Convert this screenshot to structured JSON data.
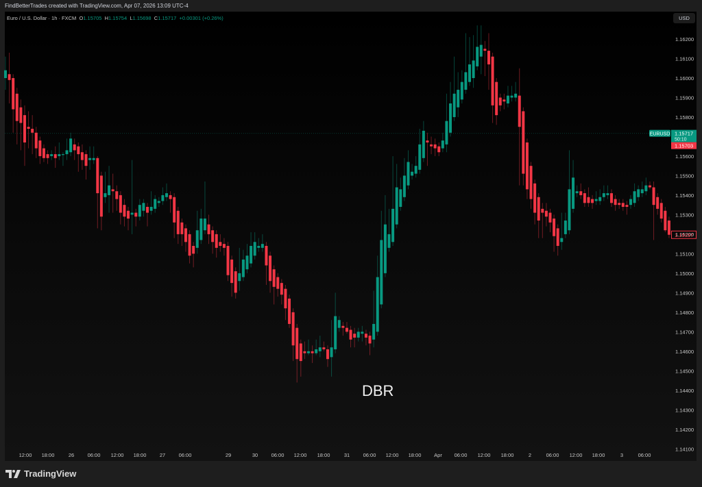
{
  "header": {
    "attribution": "FindBetterTrades created with TradingView.com, Apr 07, 2026 13:09 UTC-4"
  },
  "legend": {
    "symbol": "Euro / U.S. Dollar · 1h · FXCM",
    "o_label": "O",
    "o": "1.15705",
    "h_label": "H",
    "h": "1.15754",
    "l_label": "L",
    "l": "1.15698",
    "c_label": "C",
    "c": "1.15717",
    "change": "+0.00301 (+0.26%)"
  },
  "currency_button": "USD",
  "price_badges": {
    "symbol": "EURUSD",
    "last": "1.15717",
    "countdown": "50:10",
    "bid": "1.15703",
    "marker": "1.15197"
  },
  "annotation": "DBR",
  "footer": {
    "brand": "TradingView"
  },
  "colors": {
    "up": "#089981",
    "down": "#f23645"
  },
  "chart_data": {
    "type": "candlestick",
    "title": "Euro / U.S. Dollar · 1h · FXCM",
    "ylim": [
      1.141,
      1.1628
    ],
    "yticks": [
      "1.16200",
      "1.16100",
      "1.16000",
      "1.15900",
      "1.15800",
      "1.15700",
      "1.15600",
      "1.15500",
      "1.15400",
      "1.15300",
      "1.15200",
      "1.15100",
      "1.15000",
      "1.14900",
      "1.14800",
      "1.14700",
      "1.14600",
      "1.14500",
      "1.14400",
      "1.14300",
      "1.14200",
      "1.14100"
    ],
    "xticks": [
      "12:00",
      "18:00",
      "26",
      "06:00",
      "12:00",
      "18:00",
      "27",
      "06:00",
      "29",
      "30",
      "06:00",
      "12:00",
      "18:00",
      "31",
      "06:00",
      "12:00",
      "18:00",
      "Apr",
      "06:00",
      "12:00",
      "18:00",
      "2",
      "06:00",
      "12:00",
      "18:00",
      "3",
      "06:00"
    ],
    "current_price": 1.15717,
    "ohlc": [
      [
        1.16,
        1.1611,
        1.1594,
        1.1604
      ],
      [
        1.1602,
        1.1613,
        1.1587,
        1.1599
      ],
      [
        1.16,
        1.1602,
        1.1572,
        1.1584
      ],
      [
        1.1592,
        1.1595,
        1.1566,
        1.1578
      ],
      [
        1.1585,
        1.1589,
        1.1563,
        1.1577
      ],
      [
        1.1581,
        1.1586,
        1.1555,
        1.1567
      ],
      [
        1.1575,
        1.1583,
        1.1564,
        1.1574
      ],
      [
        1.1574,
        1.1581,
        1.1561,
        1.1572
      ],
      [
        1.1572,
        1.1575,
        1.1559,
        1.1564
      ],
      [
        1.1568,
        1.157,
        1.1556,
        1.156
      ],
      [
        1.1564,
        1.1566,
        1.1557,
        1.1559
      ],
      [
        1.1561,
        1.1563,
        1.1556,
        1.1559
      ],
      [
        1.156,
        1.1563,
        1.1558,
        1.1561
      ],
      [
        1.1561,
        1.1565,
        1.1554,
        1.1559
      ],
      [
        1.156,
        1.1567,
        1.1558,
        1.1561
      ],
      [
        1.1561,
        1.1562,
        1.1555,
        1.1561
      ],
      [
        1.1561,
        1.1569,
        1.1558,
        1.1563
      ],
      [
        1.1562,
        1.1572,
        1.156,
        1.1569
      ],
      [
        1.1566,
        1.1569,
        1.1558,
        1.1563
      ],
      [
        1.1565,
        1.1567,
        1.1552,
        1.1561
      ],
      [
        1.1562,
        1.1566,
        1.1553,
        1.1558
      ],
      [
        1.1561,
        1.1563,
        1.1548,
        1.1555
      ],
      [
        1.1558,
        1.1565,
        1.1553,
        1.1559
      ],
      [
        1.1558,
        1.1565,
        1.1556,
        1.1559
      ],
      [
        1.1559,
        1.156,
        1.1523,
        1.1541
      ],
      [
        1.155,
        1.1552,
        1.1522,
        1.1529
      ],
      [
        1.1539,
        1.1552,
        1.1536,
        1.1541
      ],
      [
        1.154,
        1.1555,
        1.1531,
        1.1545
      ],
      [
        1.1543,
        1.1551,
        1.1531,
        1.1542
      ],
      [
        1.1542,
        1.1545,
        1.1532,
        1.1538
      ],
      [
        1.154,
        1.1542,
        1.1525,
        1.1531
      ],
      [
        1.1535,
        1.1538,
        1.1524,
        1.1529
      ],
      [
        1.1532,
        1.1534,
        1.1522,
        1.1528
      ],
      [
        1.153,
        1.1558,
        1.152,
        1.1531
      ],
      [
        1.1531,
        1.1533,
        1.1524,
        1.1529
      ],
      [
        1.1529,
        1.1538,
        1.1527,
        1.1535
      ],
      [
        1.1532,
        1.1538,
        1.1529,
        1.1536
      ],
      [
        1.1534,
        1.1536,
        1.1524,
        1.1531
      ],
      [
        1.1532,
        1.1542,
        1.153,
        1.1534
      ],
      [
        1.1533,
        1.154,
        1.1531,
        1.1538
      ],
      [
        1.1536,
        1.1539,
        1.1534,
        1.1537
      ],
      [
        1.1537,
        1.1544,
        1.1535,
        1.154
      ],
      [
        1.1539,
        1.1546,
        1.1537,
        1.1541
      ],
      [
        1.154,
        1.1542,
        1.1531,
        1.1538
      ],
      [
        1.1539,
        1.1541,
        1.1518,
        1.1526
      ],
      [
        1.1532,
        1.1534,
        1.1515,
        1.152
      ],
      [
        1.1526,
        1.1528,
        1.1514,
        1.152
      ],
      [
        1.1523,
        1.1525,
        1.1511,
        1.1516
      ],
      [
        1.152,
        1.1522,
        1.1505,
        1.1509
      ],
      [
        1.1514,
        1.1516,
        1.1503,
        1.151
      ],
      [
        1.1513,
        1.1532,
        1.151,
        1.1522
      ],
      [
        1.1517,
        1.1533,
        1.1515,
        1.1528
      ],
      [
        1.1522,
        1.1547,
        1.152,
        1.1528
      ],
      [
        1.1525,
        1.153,
        1.1515,
        1.152
      ],
      [
        1.1522,
        1.1524,
        1.151,
        1.1516
      ],
      [
        1.152,
        1.1522,
        1.1508,
        1.1513
      ],
      [
        1.1516,
        1.152,
        1.1511,
        1.1514
      ],
      [
        1.1515,
        1.1518,
        1.1509,
        1.1513
      ],
      [
        1.1514,
        1.1516,
        1.1496,
        1.1499
      ],
      [
        1.1507,
        1.1509,
        1.1488,
        1.1495
      ],
      [
        1.1501,
        1.1503,
        1.1487,
        1.149
      ],
      [
        1.1496,
        1.1513,
        1.1491,
        1.15
      ],
      [
        1.1498,
        1.1512,
        1.1496,
        1.1507
      ],
      [
        1.1502,
        1.1515,
        1.15,
        1.1509
      ],
      [
        1.1505,
        1.1521,
        1.1503,
        1.1514
      ],
      [
        1.1509,
        1.1521,
        1.1507,
        1.1516
      ],
      [
        1.1513,
        1.1518,
        1.1511,
        1.1514
      ],
      [
        1.1513,
        1.152,
        1.1511,
        1.1515
      ],
      [
        1.1514,
        1.1516,
        1.1494,
        1.1504
      ],
      [
        1.1509,
        1.1511,
        1.149,
        1.1496
      ],
      [
        1.1502,
        1.1504,
        1.1484,
        1.1493
      ],
      [
        1.1498,
        1.15,
        1.1488,
        1.1492
      ],
      [
        1.1495,
        1.1497,
        1.1484,
        1.1489
      ],
      [
        1.1492,
        1.1494,
        1.1476,
        1.1482
      ],
      [
        1.1487,
        1.1489,
        1.1472,
        1.1474
      ],
      [
        1.148,
        1.1482,
        1.1455,
        1.1463
      ],
      [
        1.1472,
        1.1474,
        1.1444,
        1.1456
      ],
      [
        1.1464,
        1.1466,
        1.1447,
        1.1455
      ],
      [
        1.146,
        1.1465,
        1.1456,
        1.1459
      ],
      [
        1.1459,
        1.1466,
        1.1458,
        1.146
      ],
      [
        1.146,
        1.1463,
        1.1454,
        1.1459
      ],
      [
        1.1459,
        1.1466,
        1.1458,
        1.1461
      ],
      [
        1.146,
        1.1468,
        1.1457,
        1.1462
      ],
      [
        1.1462,
        1.1465,
        1.146,
        1.1461
      ],
      [
        1.1461,
        1.1463,
        1.1452,
        1.1456
      ],
      [
        1.1457,
        1.1476,
        1.1447,
        1.1462
      ],
      [
        1.1461,
        1.149,
        1.1459,
        1.1478
      ],
      [
        1.1472,
        1.1478,
        1.147,
        1.1476
      ],
      [
        1.1473,
        1.1475,
        1.1468,
        1.1472
      ],
      [
        1.1472,
        1.1475,
        1.1469,
        1.147
      ],
      [
        1.1471,
        1.1473,
        1.1462,
        1.1466
      ],
      [
        1.1469,
        1.1472,
        1.1462,
        1.1467
      ],
      [
        1.1467,
        1.1472,
        1.1465,
        1.147
      ],
      [
        1.1469,
        1.1473,
        1.1465,
        1.147
      ],
      [
        1.1469,
        1.1471,
        1.1463,
        1.1467
      ],
      [
        1.1468,
        1.147,
        1.1458,
        1.1464
      ],
      [
        1.1466,
        1.1491,
        1.1462,
        1.1474
      ],
      [
        1.147,
        1.1509,
        1.1468,
        1.1498
      ],
      [
        1.1484,
        1.1532,
        1.1482,
        1.1517
      ],
      [
        1.15,
        1.154,
        1.1498,
        1.1525
      ],
      [
        1.1513,
        1.1533,
        1.1511,
        1.152
      ],
      [
        1.1516,
        1.156,
        1.1514,
        1.1533
      ],
      [
        1.1525,
        1.1556,
        1.1523,
        1.1544
      ],
      [
        1.1534,
        1.1549,
        1.1532,
        1.1543
      ],
      [
        1.1539,
        1.1559,
        1.1537,
        1.155
      ],
      [
        1.1545,
        1.1563,
        1.1543,
        1.1557
      ],
      [
        1.155,
        1.1556,
        1.1548,
        1.1552
      ],
      [
        1.1551,
        1.156,
        1.1549,
        1.1555
      ],
      [
        1.1553,
        1.1574,
        1.1551,
        1.1566
      ],
      [
        1.1559,
        1.1578,
        1.1557,
        1.1573
      ],
      [
        1.1568,
        1.1572,
        1.1555,
        1.1567
      ],
      [
        1.1566,
        1.157,
        1.1561,
        1.1565
      ],
      [
        1.1566,
        1.1569,
        1.156,
        1.1564
      ],
      [
        1.1565,
        1.1567,
        1.156,
        1.1562
      ],
      [
        1.1564,
        1.1572,
        1.1562,
        1.1568
      ],
      [
        1.1566,
        1.1592,
        1.1562,
        1.1578
      ],
      [
        1.1572,
        1.1598,
        1.157,
        1.1587
      ],
      [
        1.158,
        1.1611,
        1.1578,
        1.1592
      ],
      [
        1.1585,
        1.1603,
        1.158,
        1.1594
      ],
      [
        1.1589,
        1.1604,
        1.1587,
        1.1598
      ],
      [
        1.1594,
        1.1623,
        1.1592,
        1.1603
      ],
      [
        1.1598,
        1.1621,
        1.1596,
        1.1607
      ],
      [
        1.16,
        1.1622,
        1.1595,
        1.1609
      ],
      [
        1.1606,
        1.1627,
        1.1604,
        1.1616
      ],
      [
        1.1611,
        1.1627,
        1.1602,
        1.1617
      ],
      [
        1.1615,
        1.1619,
        1.1601,
        1.1614
      ],
      [
        1.1614,
        1.1623,
        1.1594,
        1.1607
      ],
      [
        1.1611,
        1.1613,
        1.1577,
        1.1586
      ],
      [
        1.1598,
        1.16,
        1.1576,
        1.1581
      ],
      [
        1.159,
        1.1592,
        1.1583,
        1.1586
      ],
      [
        1.1589,
        1.1592,
        1.1584,
        1.1588
      ],
      [
        1.1587,
        1.1596,
        1.1585,
        1.1591
      ],
      [
        1.159,
        1.1596,
        1.1588,
        1.1591
      ],
      [
        1.159,
        1.1598,
        1.1588,
        1.1592
      ],
      [
        1.1591,
        1.1605,
        1.1545,
        1.1575
      ],
      [
        1.1583,
        1.1585,
        1.1545,
        1.1551
      ],
      [
        1.1567,
        1.1569,
        1.1538,
        1.1543
      ],
      [
        1.1555,
        1.1557,
        1.1533,
        1.1538
      ],
      [
        1.1546,
        1.1548,
        1.1525,
        1.1531
      ],
      [
        1.1539,
        1.1541,
        1.1518,
        1.1527
      ],
      [
        1.1533,
        1.1536,
        1.1518,
        1.1531
      ],
      [
        1.1532,
        1.1536,
        1.1524,
        1.1529
      ],
      [
        1.1531,
        1.1533,
        1.1521,
        1.1526
      ],
      [
        1.1528,
        1.153,
        1.1511,
        1.1519
      ],
      [
        1.1523,
        1.1525,
        1.1509,
        1.1514
      ],
      [
        1.1516,
        1.1531,
        1.1512,
        1.1518
      ],
      [
        1.152,
        1.1531,
        1.1518,
        1.1527
      ],
      [
        1.1522,
        1.1563,
        1.152,
        1.1543
      ],
      [
        1.1533,
        1.1558,
        1.1531,
        1.1549
      ],
      [
        1.1541,
        1.1545,
        1.1539,
        1.1542
      ],
      [
        1.1542,
        1.1546,
        1.1538,
        1.154
      ],
      [
        1.1541,
        1.1543,
        1.1534,
        1.1536
      ],
      [
        1.1539,
        1.1544,
        1.1534,
        1.1536
      ],
      [
        1.1538,
        1.154,
        1.1533,
        1.1536
      ],
      [
        1.1537,
        1.1542,
        1.1535,
        1.1538
      ],
      [
        1.1537,
        1.1543,
        1.1535,
        1.1539
      ],
      [
        1.1539,
        1.1545,
        1.1537,
        1.1541
      ],
      [
        1.154,
        1.1545,
        1.1538,
        1.1541
      ],
      [
        1.1541,
        1.1543,
        1.1534,
        1.1536
      ],
      [
        1.1538,
        1.154,
        1.1532,
        1.1535
      ],
      [
        1.1536,
        1.1538,
        1.1533,
        1.1535
      ],
      [
        1.1536,
        1.1538,
        1.1532,
        1.1534
      ],
      [
        1.1535,
        1.1537,
        1.153,
        1.1534
      ],
      [
        1.1535,
        1.154,
        1.1533,
        1.1538
      ],
      [
        1.1536,
        1.1546,
        1.1534,
        1.1542
      ],
      [
        1.1539,
        1.1545,
        1.1537,
        1.1543
      ],
      [
        1.1541,
        1.1547,
        1.1539,
        1.1543
      ],
      [
        1.1542,
        1.1549,
        1.154,
        1.1545
      ],
      [
        1.1545,
        1.1547,
        1.1543,
        1.1544
      ],
      [
        1.1544,
        1.1547,
        1.1517,
        1.1535
      ],
      [
        1.1539,
        1.1541,
        1.153,
        1.1533
      ],
      [
        1.1536,
        1.1538,
        1.1526,
        1.1528
      ],
      [
        1.1532,
        1.1534,
        1.1521,
        1.1522
      ],
      [
        1.1527,
        1.1529,
        1.1518,
        1.15197
      ]
    ]
  }
}
